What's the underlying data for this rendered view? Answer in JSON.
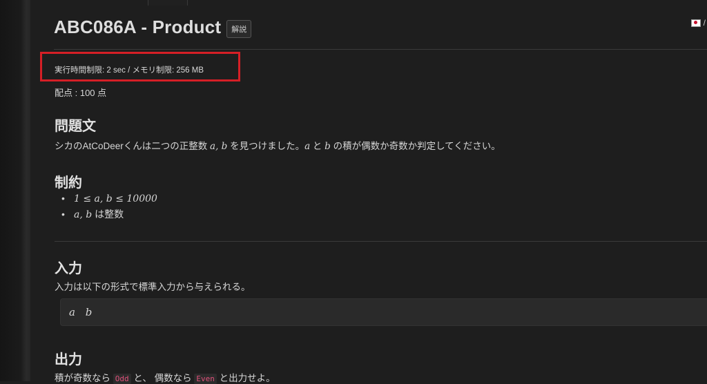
{
  "header": {
    "title": "ABC086A - Product",
    "editorial_label": "解説",
    "lang_label": "/"
  },
  "limits": {
    "text": "実行時間制限: 2 sec / メモリ制限: 256 MB"
  },
  "score": {
    "text": "配点 : 100 点"
  },
  "problem": {
    "heading": "問題文",
    "text_pre": "シカのAtCoDeerくんは二つの正整数 ",
    "math_ab": "a, b",
    "text_mid": " を見つけました。",
    "math_a": "a",
    "text_and": " と ",
    "math_b": "b",
    "text_post": " の積が偶数か奇数か判定してください。"
  },
  "constraints": {
    "heading": "制約",
    "item1_math": "1 ≤ a, b ≤ 10000",
    "item2_math": "a, b",
    "item2_text": " は整数"
  },
  "input": {
    "heading": "入力",
    "text": "入力は以下の形式で標準入力から与えられる。",
    "format": "a b"
  },
  "output": {
    "heading": "出力",
    "text_pre": "積が奇数なら ",
    "odd": "Odd",
    "text_mid": " と、 偶数なら ",
    "even": "Even",
    "text_post": " と出力せよ。"
  },
  "colors": {
    "highlight_box": "#d61f26",
    "inline_code": "#e0507a",
    "background": "#1e1e1e"
  }
}
